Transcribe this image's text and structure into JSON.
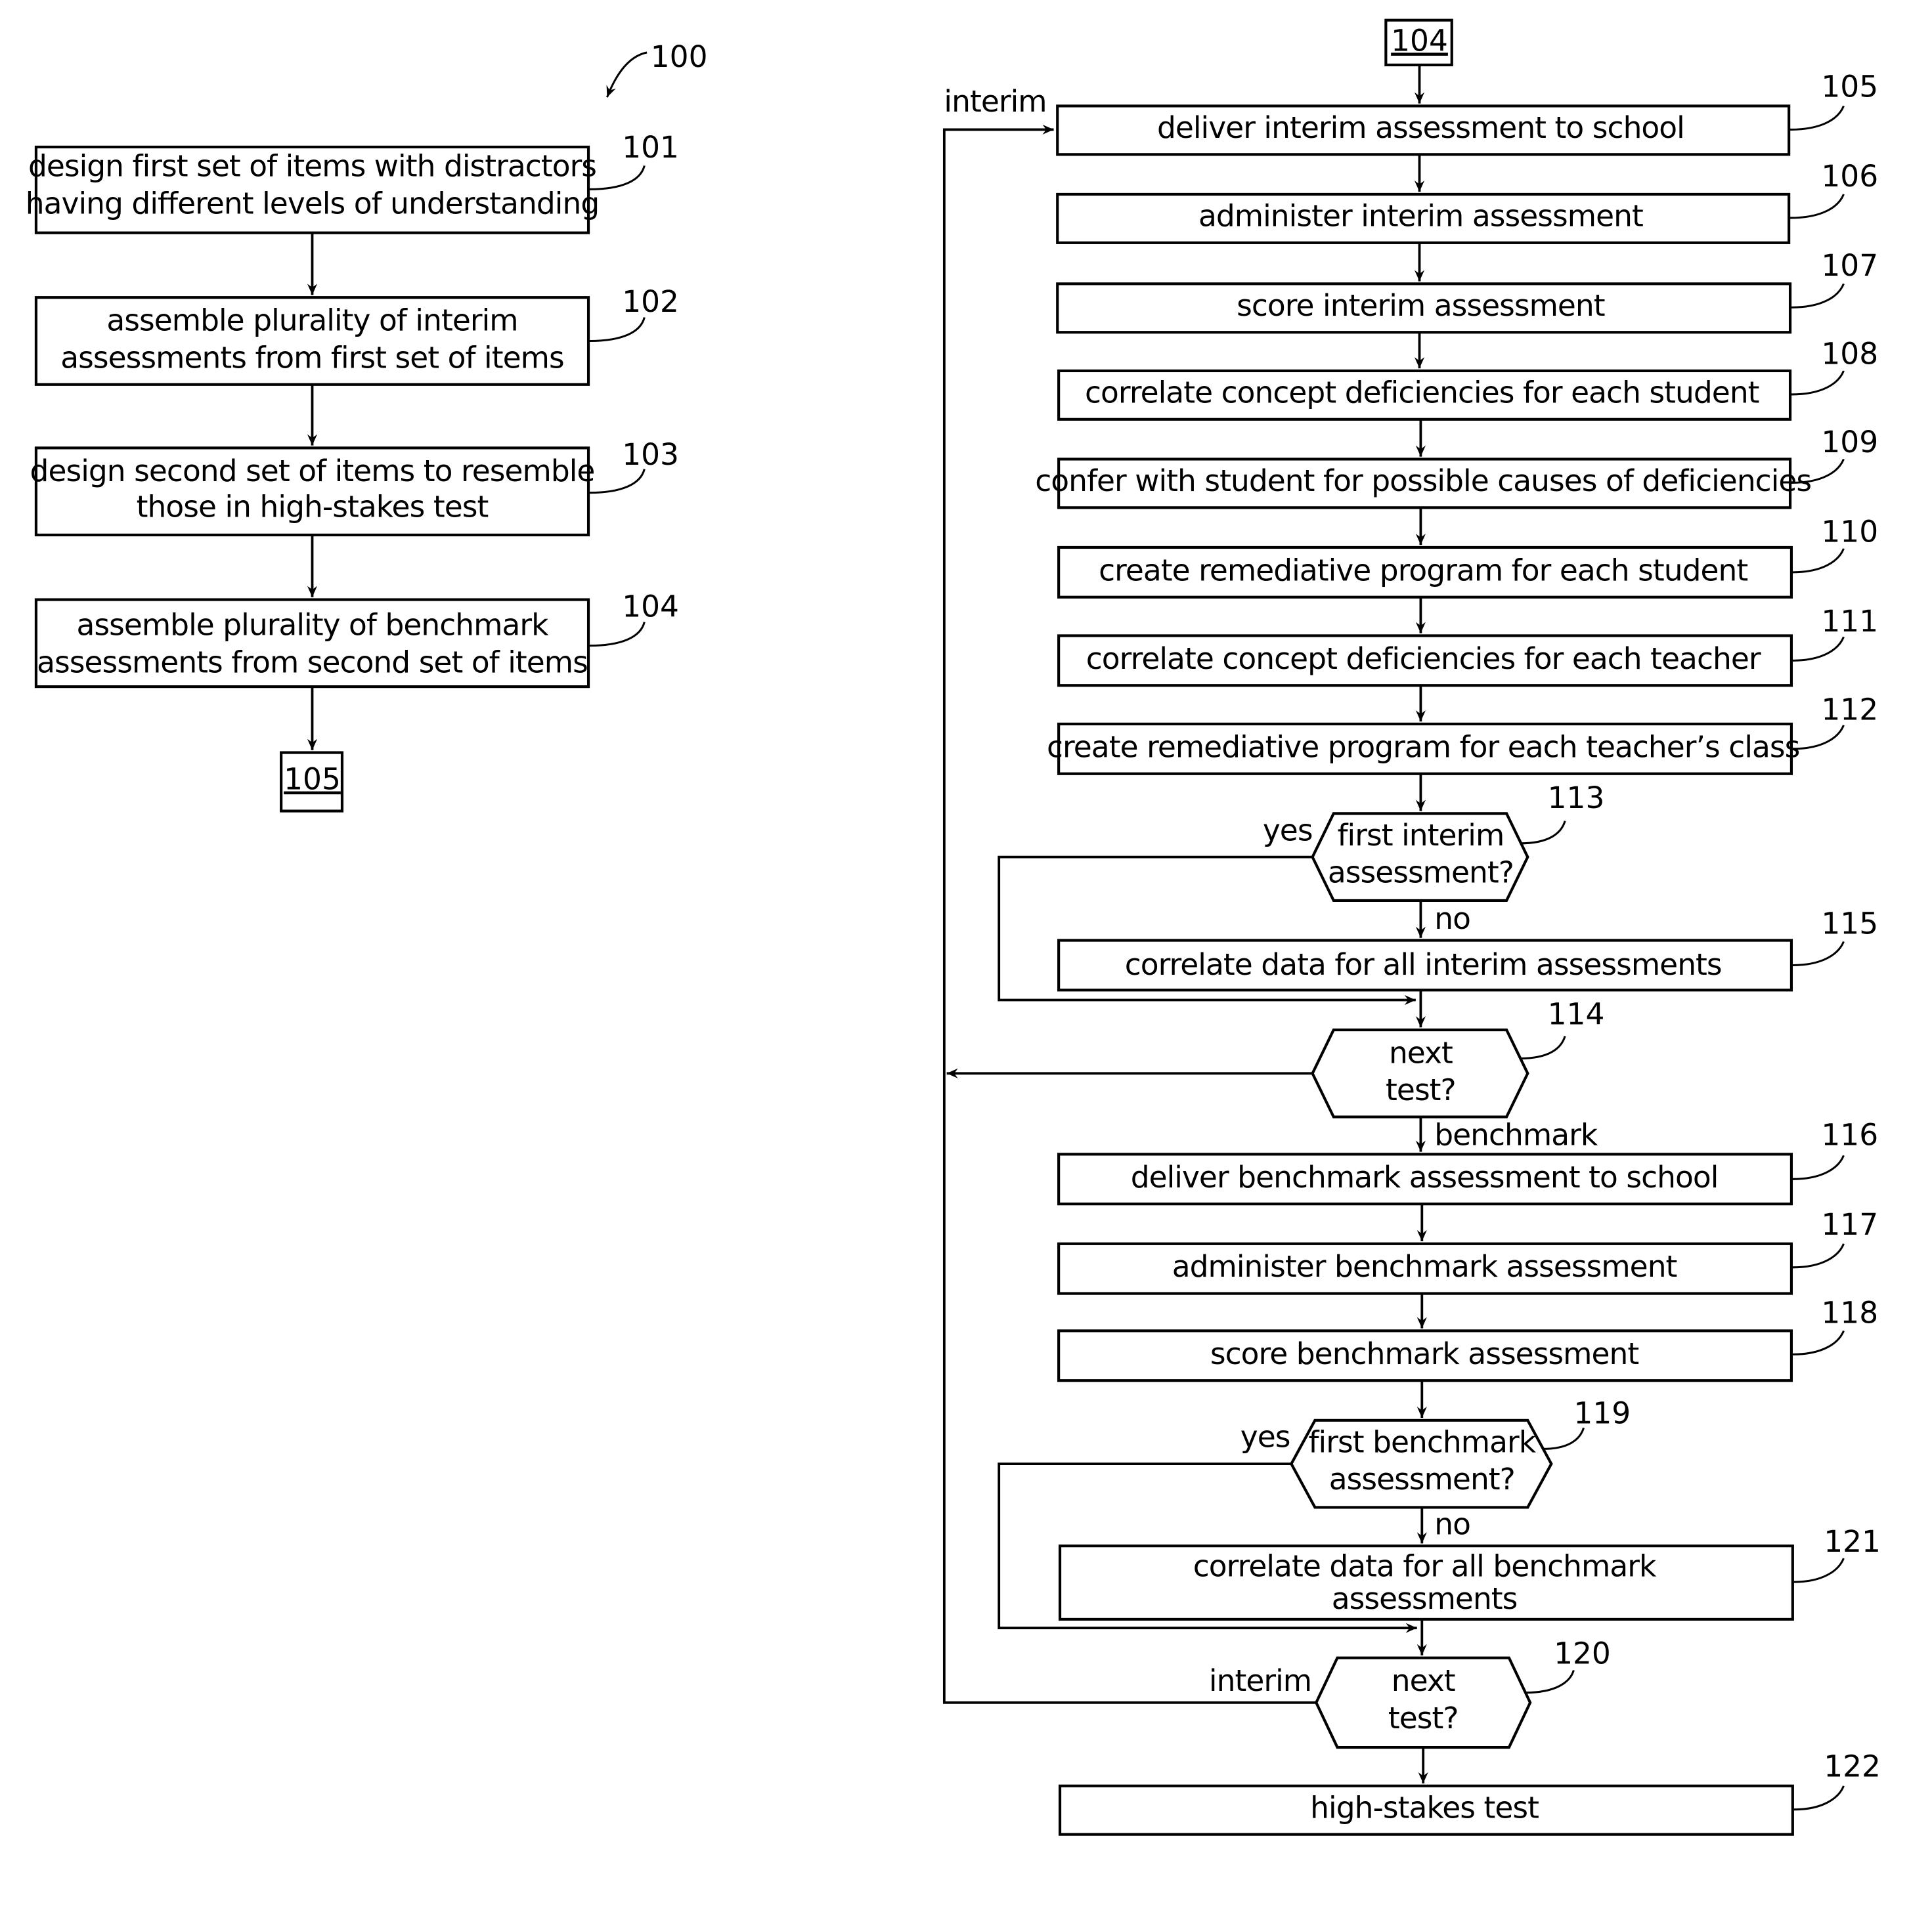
{
  "figure_ref": "100",
  "left_flow": {
    "steps": [
      {
        "id": "101",
        "lines": [
          "design first set of items with distractors",
          "having different levels of understanding"
        ]
      },
      {
        "id": "102",
        "lines": [
          "assemble plurality of interim",
          "assessments from first set of items"
        ]
      },
      {
        "id": "103",
        "lines": [
          "design second set of items to resemble",
          "those in high-stakes test"
        ]
      },
      {
        "id": "104",
        "lines": [
          "assemble plurality of benchmark",
          "assessments from second set of items"
        ]
      }
    ],
    "off_page_connector": "105"
  },
  "right_flow": {
    "entry_connector": "104",
    "loop_label": "interim",
    "steps": [
      {
        "id": "105",
        "lines": [
          "deliver interim assessment to school"
        ]
      },
      {
        "id": "106",
        "lines": [
          "administer interim assessment"
        ]
      },
      {
        "id": "107",
        "lines": [
          "score interim assessment"
        ]
      },
      {
        "id": "108",
        "lines": [
          "correlate concept deficiencies for each student"
        ]
      },
      {
        "id": "109",
        "lines": [
          "confer with student for possible causes of deficiencies"
        ]
      },
      {
        "id": "110",
        "lines": [
          "create remediative program for each student"
        ]
      },
      {
        "id": "111",
        "lines": [
          "correlate concept deficiencies for each teacher"
        ]
      },
      {
        "id": "112",
        "lines": [
          "create remediative program for each teacher’s class"
        ]
      },
      {
        "id": "115",
        "lines": [
          "correlate data for all interim assessments"
        ]
      },
      {
        "id": "116",
        "lines": [
          "deliver benchmark assessment to school"
        ]
      },
      {
        "id": "117",
        "lines": [
          "administer benchmark assessment"
        ]
      },
      {
        "id": "118",
        "lines": [
          "score benchmark assessment"
        ]
      },
      {
        "id": "121",
        "lines": [
          "correlate data for all benchmark",
          "assessments"
        ]
      },
      {
        "id": "122",
        "lines": [
          "high-stakes test"
        ]
      }
    ],
    "decisions": [
      {
        "id": "113",
        "lines": [
          "first interim",
          "assessment?"
        ],
        "yes_label": "yes",
        "no_label": "no"
      },
      {
        "id": "114",
        "lines": [
          "next",
          "test?"
        ],
        "down_label": "benchmark"
      },
      {
        "id": "119",
        "lines": [
          "first benchmark",
          "assessment?"
        ],
        "yes_label": "yes",
        "no_label": "no"
      },
      {
        "id": "120",
        "lines": [
          "next",
          "test?"
        ],
        "left_label": "interim"
      }
    ]
  }
}
